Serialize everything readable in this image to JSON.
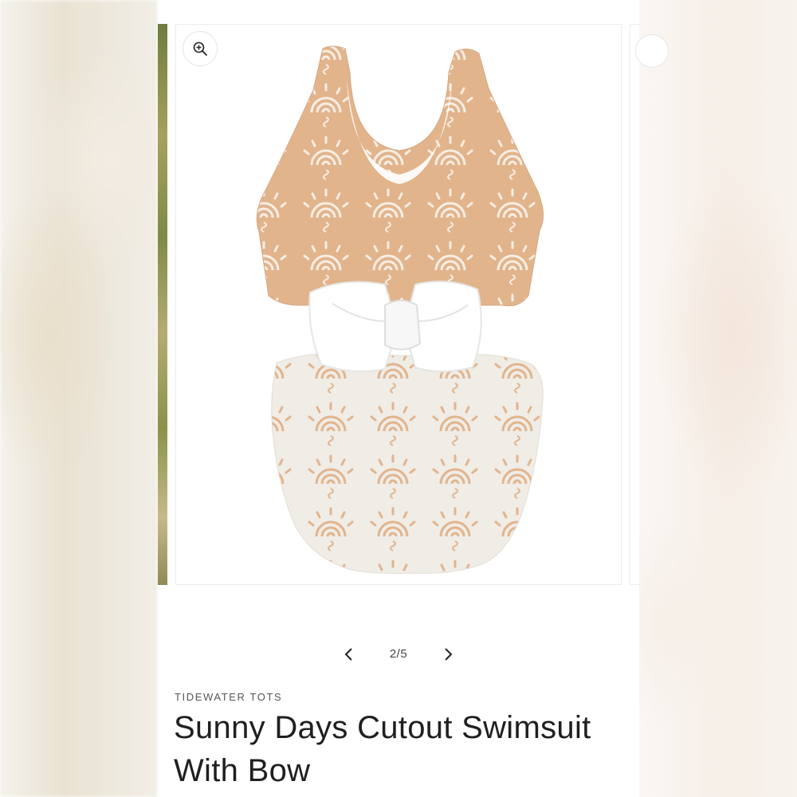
{
  "gallery": {
    "slide_counter": "2/5",
    "zoom_icon": "zoom-in-icon",
    "prev_icon": "chevron-left-icon",
    "next_icon": "chevron-right-icon",
    "image": "white-swimsuit-with-bow-back-view",
    "print_color": "#e2b48c",
    "base_color": "#f0ece6"
  },
  "product": {
    "vendor": "TIDEWATER TOTS",
    "title": "Sunny Days Cutout Swimsuit With Bow"
  }
}
